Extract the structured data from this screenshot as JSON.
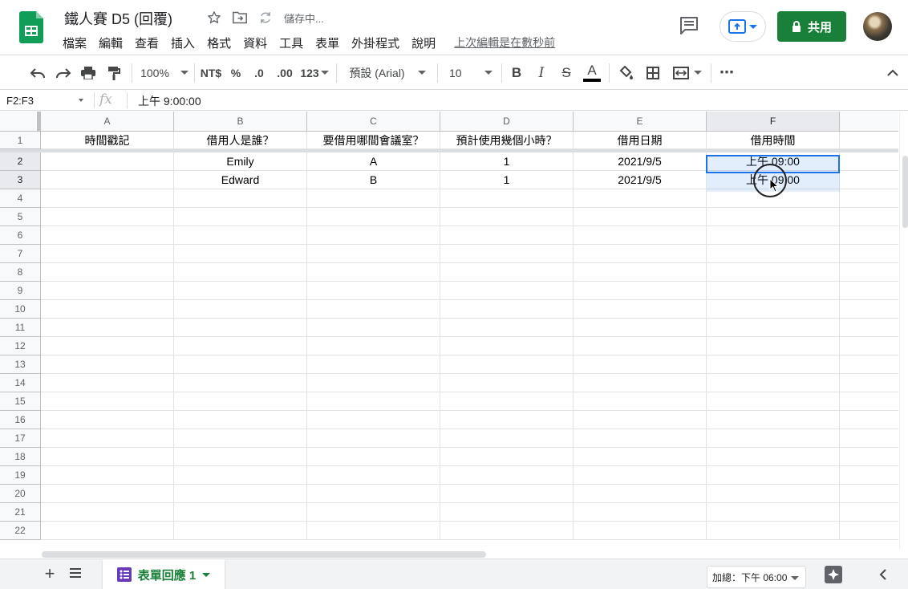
{
  "app": {
    "doc_title": "鐵人賽 D5 (回覆)",
    "saving_status": "儲存中...",
    "last_edit": "上次編輯是在數秒前"
  },
  "menu": [
    "檔案",
    "編輯",
    "查看",
    "插入",
    "格式",
    "資料",
    "工具",
    "表單",
    "外掛程式",
    "說明"
  ],
  "header_actions": {
    "share_label": "共用"
  },
  "toolbar": {
    "zoom": "100%",
    "currency": "NT$",
    "percent": "%",
    "decrease_decimal": ".0",
    "increase_decimal": ".00",
    "more_formats": "123",
    "font": "預設 (Arial)",
    "font_size": "10",
    "bold": "B",
    "italic": "I",
    "strike": "S",
    "text_color": "A",
    "more": "⋯"
  },
  "formula_bar": {
    "name_box": "F2:F3",
    "fx_label": "fx",
    "value": "上午 9:00:00"
  },
  "grid": {
    "columns": [
      "A",
      "B",
      "C",
      "D",
      "E",
      "F"
    ],
    "selected_column": "F",
    "row_numbers": [
      "1",
      "2",
      "3",
      "4",
      "5",
      "6",
      "7",
      "8",
      "9",
      "10",
      "11",
      "12",
      "13",
      "14",
      "15",
      "16",
      "17",
      "18",
      "19",
      "20",
      "21",
      "22"
    ],
    "selected_rows": [
      "2",
      "3"
    ],
    "rows": [
      [
        "時間戳記",
        "借用人是誰？",
        "要借用哪間會議室？",
        "預計使用幾個小時？",
        "借用日期",
        "借用時間"
      ],
      [
        "",
        "Emily",
        "A",
        "1",
        "2021/9/5",
        "上午 09:00"
      ],
      [
        "",
        "Edward",
        "B",
        "1",
        "2021/9/5",
        "上午 09:00"
      ]
    ]
  },
  "bottom": {
    "add_sheet": "+",
    "sheet_tab": "表單回應 1",
    "sum_label": "加總：下午 06:00"
  },
  "colors": {
    "accent_green": "#188038",
    "selection_blue": "#1a73e8"
  }
}
